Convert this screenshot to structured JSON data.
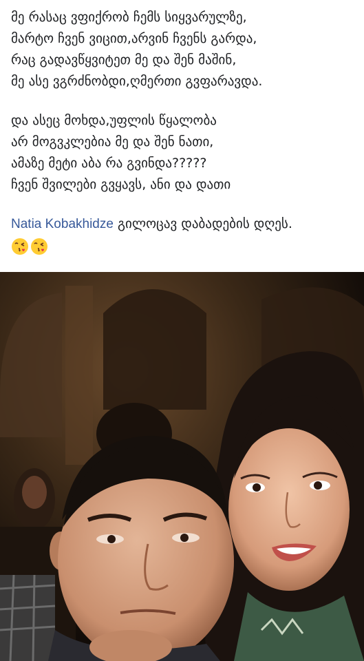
{
  "post": {
    "stanza1": [
      "მე რასაც ვფიქრობ ჩემს  სიყვარულზე,",
      "მარტო ჩვენ ვიცით,არვინ ჩვენს გარდა,",
      "რაც გადავწყვიტეთ მე და შენ მაშინ,",
      "მე ასე ვგრძნობდი,ღმერთი გვფარავდა."
    ],
    "stanza2": [
      "და ასეც მოხდა,უფლის წყალობა",
      "არ მოგვკლებია მე და შენ ნათი,",
      "ამაზე მეტი აბა რა გვინდა?????",
      "ჩვენ შვილები გვყავს, ანი და დათი"
    ],
    "mention": "Natia Kobakhidze",
    "birthday_text": " გილოცავ დაბადების დღეს.",
    "emojis": [
      "face-blowing-a-kiss",
      "face-blowing-a-kiss"
    ]
  }
}
